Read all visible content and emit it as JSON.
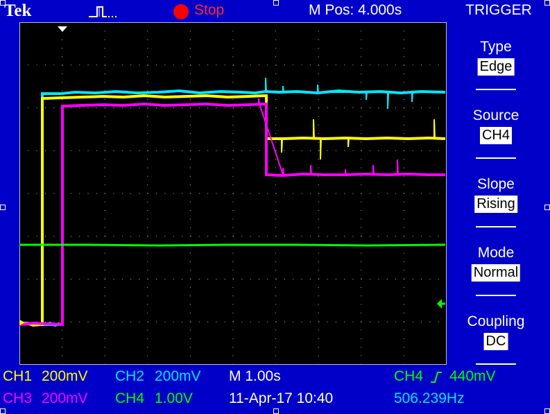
{
  "header": {
    "brand": "Tek",
    "run_state": "Stop",
    "m_pos": "M Pos: 4.000s",
    "menu_title": "TRIGGER"
  },
  "trigger_menu": [
    {
      "label": "Type",
      "value": "Edge"
    },
    {
      "label": "Source",
      "value": "CH4"
    },
    {
      "label": "Slope",
      "value": "Rising"
    },
    {
      "label": "Mode",
      "value": "Normal"
    },
    {
      "label": "Coupling",
      "value": "DC"
    }
  ],
  "status": {
    "ch1_name": "CH1",
    "ch1_scale": "200mV",
    "ch2_name": "CH2",
    "ch2_scale": "200mV",
    "ch3_name": "CH3",
    "ch3_scale": "200mV",
    "ch4_name": "CH4",
    "ch4_scale": "1.00V",
    "timebase": "M 1.00s",
    "datetime": "11-Apr-17 10:40",
    "trigger_source": "CH4",
    "trigger_level": "440mV",
    "frequency": "506.239Hz"
  },
  "colors": {
    "ch1": "#ffff00",
    "ch2": "#00e8ff",
    "ch3": "#ff00ff",
    "ch4": "#00ff00",
    "background": "#0000c8"
  },
  "icons": [
    "acquisition-pulse-icon",
    "stop-indicator-icon",
    "trigger-position-marker-icon",
    "trigger-level-arrow-icon",
    "channel-ground-marker-icon",
    "rising-edge-icon"
  ]
}
